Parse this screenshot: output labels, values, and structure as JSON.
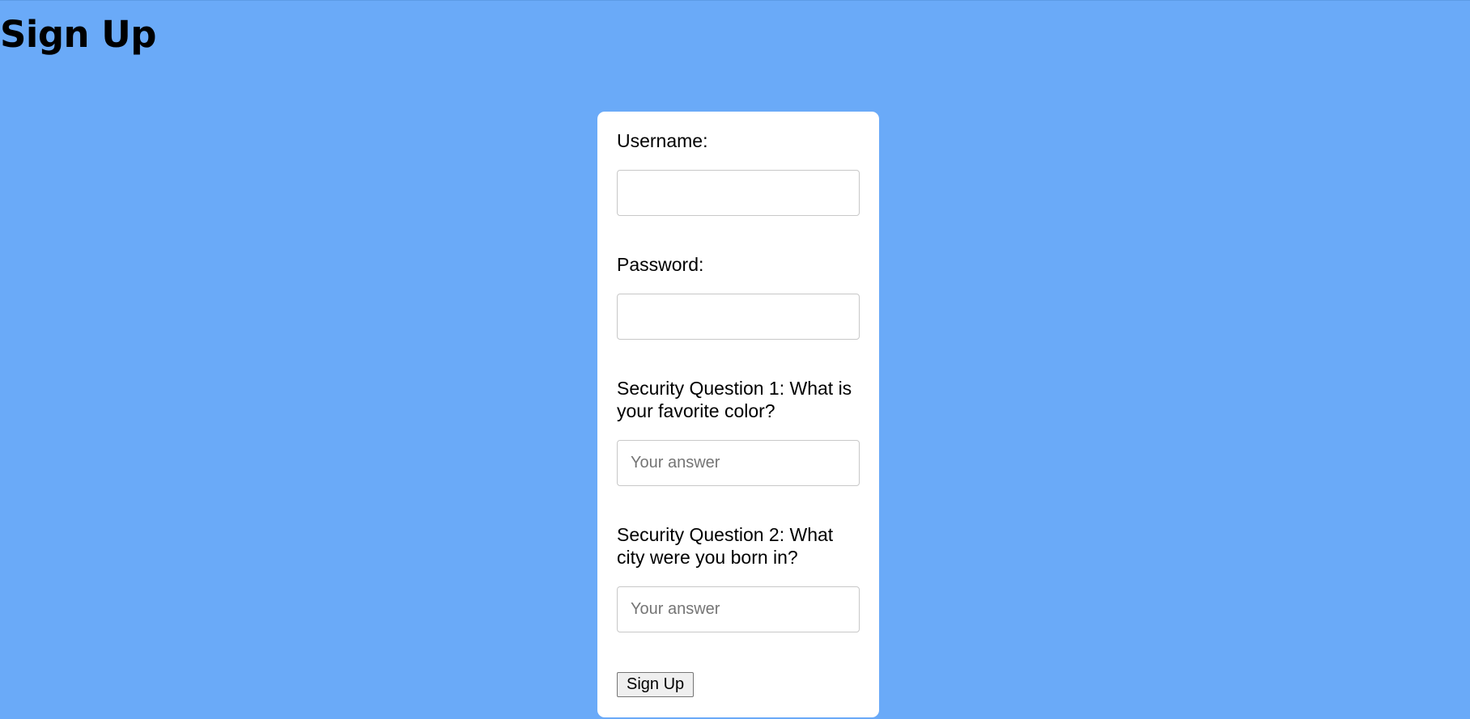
{
  "page": {
    "title": "Sign Up",
    "background_color": "#6aaaf8"
  },
  "form": {
    "username": {
      "label": "Username:",
      "value": "",
      "placeholder": ""
    },
    "password": {
      "label": "Password:",
      "value": "",
      "placeholder": ""
    },
    "security_question_1": {
      "label": "Security Question 1: What is your favorite color?",
      "value": "",
      "placeholder": "Your answer"
    },
    "security_question_2": {
      "label": "Security Question 2: What city were you born in?",
      "value": "",
      "placeholder": "Your answer"
    },
    "submit_label": "Sign Up"
  }
}
